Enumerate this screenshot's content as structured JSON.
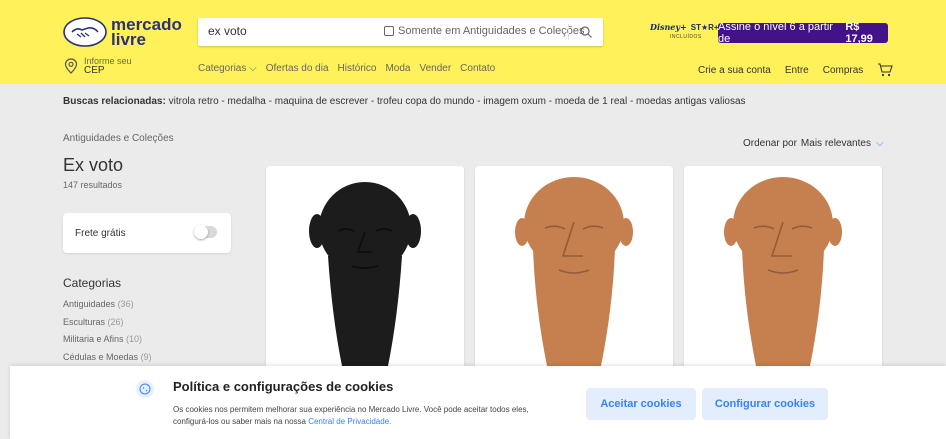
{
  "header": {
    "logo_line1": "mercado",
    "logo_line2": "livre",
    "cep_small": "Informe seu",
    "cep_big": "CEP",
    "search_value": "ex voto",
    "search_option": "Somente em Antiguidades e Coleções",
    "promo_brand": "Disney+",
    "promo_brand2": "ST★R+",
    "promo_included": "INCLUÍDOS",
    "promo_text": "Assine o nível 6 a partir de",
    "promo_price": "R$ 17,99",
    "nav": [
      "Categorias ⌵",
      "Ofertas do dia",
      "Histórico",
      "Moda",
      "Vender",
      "Contato"
    ],
    "account": [
      "Crie a sua conta",
      "Entre",
      "Compras"
    ]
  },
  "related": {
    "label": "Buscas relacionadas:",
    "items": "vitrola retro  -  medalha  -  maquina de escrever  -  trofeu copa do mundo  -  imagem oxum  -  moeda de 1 real  -  moedas antigas valiosas"
  },
  "breadcrumb": "Antiguidades e Coleções",
  "sort": {
    "label": "Ordenar por",
    "value": "Mais relevantes"
  },
  "results": {
    "title": "Ex voto",
    "count": "147 resultados"
  },
  "filters": {
    "frete": "Frete grátis",
    "categories_title": "Categorias",
    "categories": [
      {
        "name": "Antiguidades",
        "count": "(36)"
      },
      {
        "name": "Esculturas",
        "count": "(26)"
      },
      {
        "name": "Militaria e Afins",
        "count": "(10)"
      },
      {
        "name": "Cédulas e Moedas",
        "count": "(9)"
      }
    ]
  },
  "products": [
    {
      "color": "#1c1c1c"
    },
    {
      "color": "#c67f4f"
    },
    {
      "color": "#c67f4f"
    }
  ],
  "cookies": {
    "title": "Política e configurações de cookies",
    "text": "Os cookies nos permitem melhorar sua experiência no Mercado Livre. Você pode aceitar todos eles, configurá-los ou saber mais na nossa",
    "link": "Central de Privacidade.",
    "accept": "Aceitar cookies",
    "configure": "Configurar cookies"
  }
}
